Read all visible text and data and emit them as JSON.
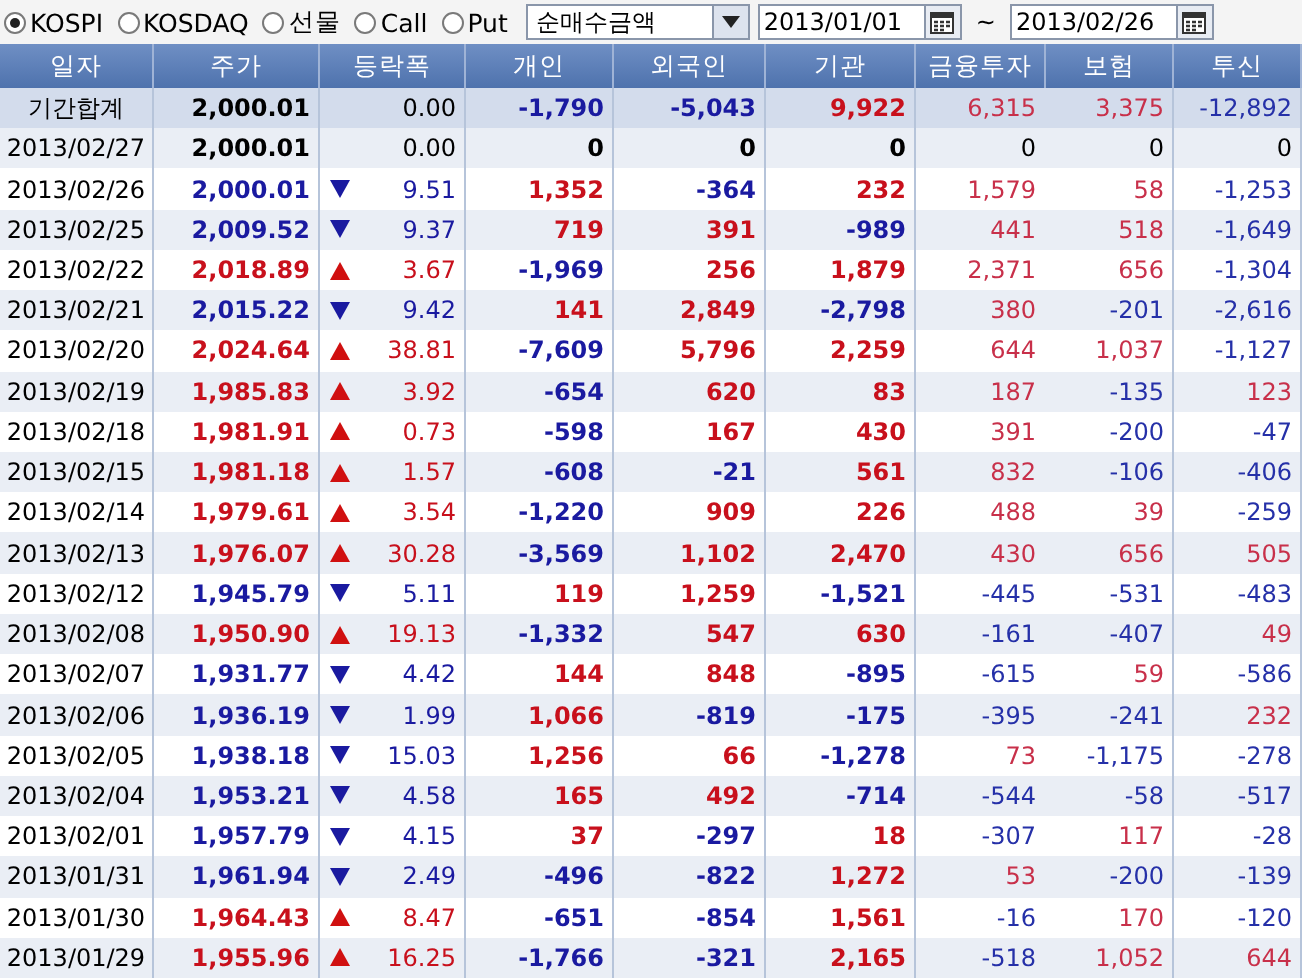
{
  "markets": [
    {
      "label": "KOSPI",
      "selected": true
    },
    {
      "label": "KOSDAQ",
      "selected": false
    },
    {
      "label": "선물",
      "selected": false
    },
    {
      "label": "Call",
      "selected": false
    },
    {
      "label": "Put",
      "selected": false
    }
  ],
  "metric_select": {
    "value": "순매수금액"
  },
  "date_from": {
    "value": "2013/01/01"
  },
  "range_separator": "~",
  "date_to": {
    "value": "2013/02/26"
  },
  "table": {
    "columns": [
      "일자",
      "주가",
      "등락폭",
      "개인",
      "외국인",
      "기관",
      "금융투자",
      "보험",
      "투신"
    ],
    "summary": {
      "date": "기간합계",
      "price": "2,000.01",
      "change": "0.00",
      "values": [
        "-1,790",
        "-5,043",
        "9,922",
        "6,315",
        "3,375",
        "-12,892"
      ]
    },
    "rows": [
      {
        "date": "2013/02/27",
        "price": "2,000.01",
        "kind": "flat",
        "change": "0.00",
        "values": [
          "0",
          "0",
          "0",
          "0",
          "0",
          "0"
        ]
      },
      {
        "date": "2013/02/26",
        "price": "2,000.01",
        "kind": "down",
        "change": "9.51",
        "values": [
          "1,352",
          "-364",
          "232",
          "1,579",
          "58",
          "-1,253"
        ]
      },
      {
        "date": "2013/02/25",
        "price": "2,009.52",
        "kind": "down",
        "change": "9.37",
        "values": [
          "719",
          "391",
          "-989",
          "441",
          "518",
          "-1,649"
        ]
      },
      {
        "date": "2013/02/22",
        "price": "2,018.89",
        "kind": "up",
        "change": "3.67",
        "values": [
          "-1,969",
          "256",
          "1,879",
          "2,371",
          "656",
          "-1,304"
        ]
      },
      {
        "date": "2013/02/21",
        "price": "2,015.22",
        "kind": "down",
        "change": "9.42",
        "values": [
          "141",
          "2,849",
          "-2,798",
          "380",
          "-201",
          "-2,616"
        ]
      },
      {
        "date": "2013/02/20",
        "price": "2,024.64",
        "kind": "up",
        "change": "38.81",
        "values": [
          "-7,609",
          "5,796",
          "2,259",
          "644",
          "1,037",
          "-1,127"
        ]
      },
      {
        "date": "2013/02/19",
        "price": "1,985.83",
        "kind": "up",
        "change": "3.92",
        "values": [
          "-654",
          "620",
          "83",
          "187",
          "-135",
          "123"
        ]
      },
      {
        "date": "2013/02/18",
        "price": "1,981.91",
        "kind": "up",
        "change": "0.73",
        "values": [
          "-598",
          "167",
          "430",
          "391",
          "-200",
          "-47"
        ]
      },
      {
        "date": "2013/02/15",
        "price": "1,981.18",
        "kind": "up",
        "change": "1.57",
        "values": [
          "-608",
          "-21",
          "561",
          "832",
          "-106",
          "-406"
        ]
      },
      {
        "date": "2013/02/14",
        "price": "1,979.61",
        "kind": "up",
        "change": "3.54",
        "values": [
          "-1,220",
          "909",
          "226",
          "488",
          "39",
          "-259"
        ]
      },
      {
        "date": "2013/02/13",
        "price": "1,976.07",
        "kind": "up",
        "change": "30.28",
        "values": [
          "-3,569",
          "1,102",
          "2,470",
          "430",
          "656",
          "505"
        ]
      },
      {
        "date": "2013/02/12",
        "price": "1,945.79",
        "kind": "down",
        "change": "5.11",
        "values": [
          "119",
          "1,259",
          "-1,521",
          "-445",
          "-531",
          "-483"
        ]
      },
      {
        "date": "2013/02/08",
        "price": "1,950.90",
        "kind": "up",
        "change": "19.13",
        "values": [
          "-1,332",
          "547",
          "630",
          "-161",
          "-407",
          "49"
        ]
      },
      {
        "date": "2013/02/07",
        "price": "1,931.77",
        "kind": "down",
        "change": "4.42",
        "values": [
          "144",
          "848",
          "-895",
          "-615",
          "59",
          "-586"
        ]
      },
      {
        "date": "2013/02/06",
        "price": "1,936.19",
        "kind": "down",
        "change": "1.99",
        "values": [
          "1,066",
          "-819",
          "-175",
          "-395",
          "-241",
          "232"
        ]
      },
      {
        "date": "2013/02/05",
        "price": "1,938.18",
        "kind": "down",
        "change": "15.03",
        "values": [
          "1,256",
          "66",
          "-1,278",
          "73",
          "-1,175",
          "-278"
        ]
      },
      {
        "date": "2013/02/04",
        "price": "1,953.21",
        "kind": "down",
        "change": "4.58",
        "values": [
          "165",
          "492",
          "-714",
          "-544",
          "-58",
          "-517"
        ]
      },
      {
        "date": "2013/02/01",
        "price": "1,957.79",
        "kind": "down",
        "change": "4.15",
        "values": [
          "37",
          "-297",
          "18",
          "-307",
          "117",
          "-28"
        ]
      },
      {
        "date": "2013/01/31",
        "price": "1,961.94",
        "kind": "down",
        "change": "2.49",
        "values": [
          "-496",
          "-822",
          "1,272",
          "53",
          "-200",
          "-139"
        ]
      },
      {
        "date": "2013/01/30",
        "price": "1,964.43",
        "kind": "up",
        "change": "8.47",
        "values": [
          "-651",
          "-854",
          "1,561",
          "-16",
          "170",
          "-120"
        ]
      },
      {
        "date": "2013/01/29",
        "price": "1,955.96",
        "kind": "up",
        "change": "16.25",
        "values": [
          "-1,766",
          "-321",
          "2,165",
          "-518",
          "1,052",
          "644"
        ]
      }
    ]
  }
}
